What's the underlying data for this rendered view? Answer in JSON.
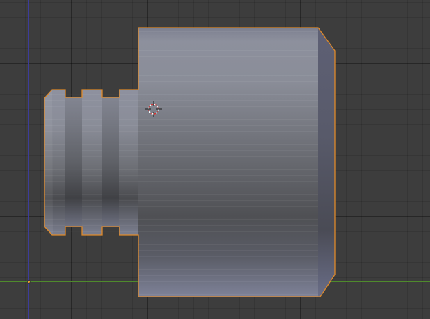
{
  "viewport": {
    "background_color": "#3d3d3d",
    "axis_colors": {
      "x_axis": "#4f8a2c",
      "y_axis": "#3c3c9a"
    },
    "selection_outline_color": "#e08a2a",
    "object": {
      "name": "",
      "shading": "solid",
      "base_color": "#8f92a0"
    },
    "origin_marker": {
      "icon": "origin-dot-icon",
      "color": "#f0a030"
    },
    "cursor": {
      "icon": "3d-cursor-icon"
    }
  }
}
